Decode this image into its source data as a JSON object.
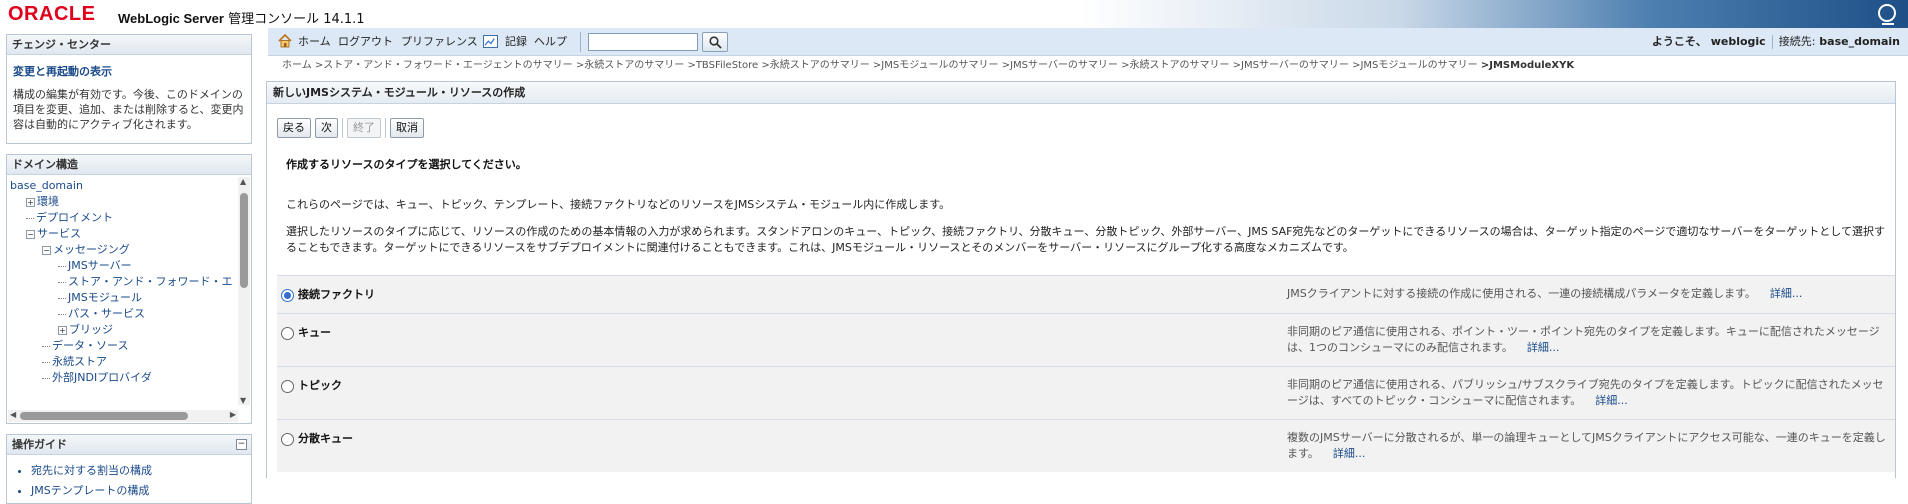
{
  "banner": {
    "logo": "ORACLE",
    "product_bold": "WebLogic Server",
    "product_rest": " 管理コンソール 14.1.1",
    "help_icon": "speech-bubble-icon"
  },
  "change_center": {
    "title": "チェンジ・センター",
    "link": "変更と再起動の表示",
    "text": "構成の編集が有効です。今後、このドメインの項目を変更、追加、または削除すると、変更内容は自動的にアクティブ化されます。"
  },
  "domain_structure": {
    "title": "ドメイン構造",
    "tree": [
      {
        "label": "base_domain",
        "indent": 0,
        "toggle": ""
      },
      {
        "label": "環境",
        "indent": 1,
        "toggle": "+"
      },
      {
        "label": "デプロイメント",
        "indent": 1,
        "toggle": ""
      },
      {
        "label": "サービス",
        "indent": 1,
        "toggle": "-"
      },
      {
        "label": "メッセージング",
        "indent": 2,
        "toggle": "-"
      },
      {
        "label": "JMSサーバー",
        "indent": 3,
        "toggle": ""
      },
      {
        "label": "ストア・アンド・フォワード・エ",
        "indent": 3,
        "toggle": ""
      },
      {
        "label": "JMSモジュール",
        "indent": 3,
        "toggle": ""
      },
      {
        "label": "パス・サービス",
        "indent": 3,
        "toggle": ""
      },
      {
        "label": "ブリッジ",
        "indent": 3,
        "toggle": "+"
      },
      {
        "label": "データ・ソース",
        "indent": 2,
        "toggle": ""
      },
      {
        "label": "永続ストア",
        "indent": 2,
        "toggle": ""
      },
      {
        "label": "外部JNDIプロバイダ",
        "indent": 2,
        "toggle": ""
      }
    ]
  },
  "how_do_i": {
    "title": "操作ガイド",
    "items": [
      "宛先に対する割当の構成",
      "JMSテンプレートの構成"
    ]
  },
  "toolbar": {
    "home": "ホーム",
    "logout": "ログアウト",
    "preferences": "プリファレンス",
    "record": "記録",
    "help": "ヘルプ",
    "search_value": "",
    "welcome": "ようこそ、 weblogic",
    "connected_label": "接続先:",
    "connected_domain": "base_domain"
  },
  "breadcrumb": [
    "ホーム",
    ">ストア・アンド・フォワード・エージェントのサマリー",
    ">永続ストアのサマリー",
    ">TBSFileStore",
    ">永続ストアのサマリー",
    ">JMSモジュールのサマリー",
    ">JMSサーバーのサマリー",
    ">永続ストアのサマリー",
    ">JMSサーバーのサマリー",
    ">JMSモジュールのサマリー",
    ">JMSModuleXYK"
  ],
  "main": {
    "title": "新しいJMSシステム・モジュール・リソースの作成",
    "buttons": {
      "back": "戻る",
      "next": "次",
      "finish": "終了",
      "cancel": "取消"
    },
    "heading": "作成するリソースのタイプを選択してください。",
    "para1": "これらのページでは、キュー、トピック、テンプレート、接続ファクトリなどのリソースをJMSシステム・モジュール内に作成します。",
    "para2": "選択したリソースのタイプに応じて、リソースの作成のための基本情報の入力が求められます。スタンドアロンのキュー、トピック、接続ファクトリ、分散キュー、分散トピック、外部サーバー、JMS SAF宛先などのターゲットにできるリソースの場合は、ターゲット指定のページで適切なサーバーをターゲットとして選択することもできます。ターゲットにできるリソースをサブデプロイメントに関連付けることもできます。これは、JMSモジュール・リソースとそのメンバーをサーバー・リソースにグループ化する高度なメカニズムです。",
    "options": [
      {
        "label": "接続ファクトリ",
        "checked": true,
        "desc": "JMSクライアントに対する接続の作成に使用される、一連の接続構成パラメータを定義します。",
        "more": "詳細..."
      },
      {
        "label": "キュー",
        "checked": false,
        "desc": "非同期のピア通信に使用される、ポイント・ツー・ポイント宛先のタイプを定義します。キューに配信されたメッセージは、1つのコンシューマにのみ配信されます。",
        "more": "詳細..."
      },
      {
        "label": "トピック",
        "checked": false,
        "desc": "非同期のピア通信に使用される、パブリッシュ/サブスクライブ宛先のタイプを定義します。トピックに配信されたメッセージは、すべてのトピック・コンシューマに配信されます。",
        "more": "詳細..."
      },
      {
        "label": "分散キュー",
        "checked": false,
        "desc": "複数のJMSサーバーに分散されるが、単一の論理キューとしてJMSクライアントにアクセス可能な、一連のキューを定義します。",
        "more": "詳細..."
      }
    ]
  }
}
